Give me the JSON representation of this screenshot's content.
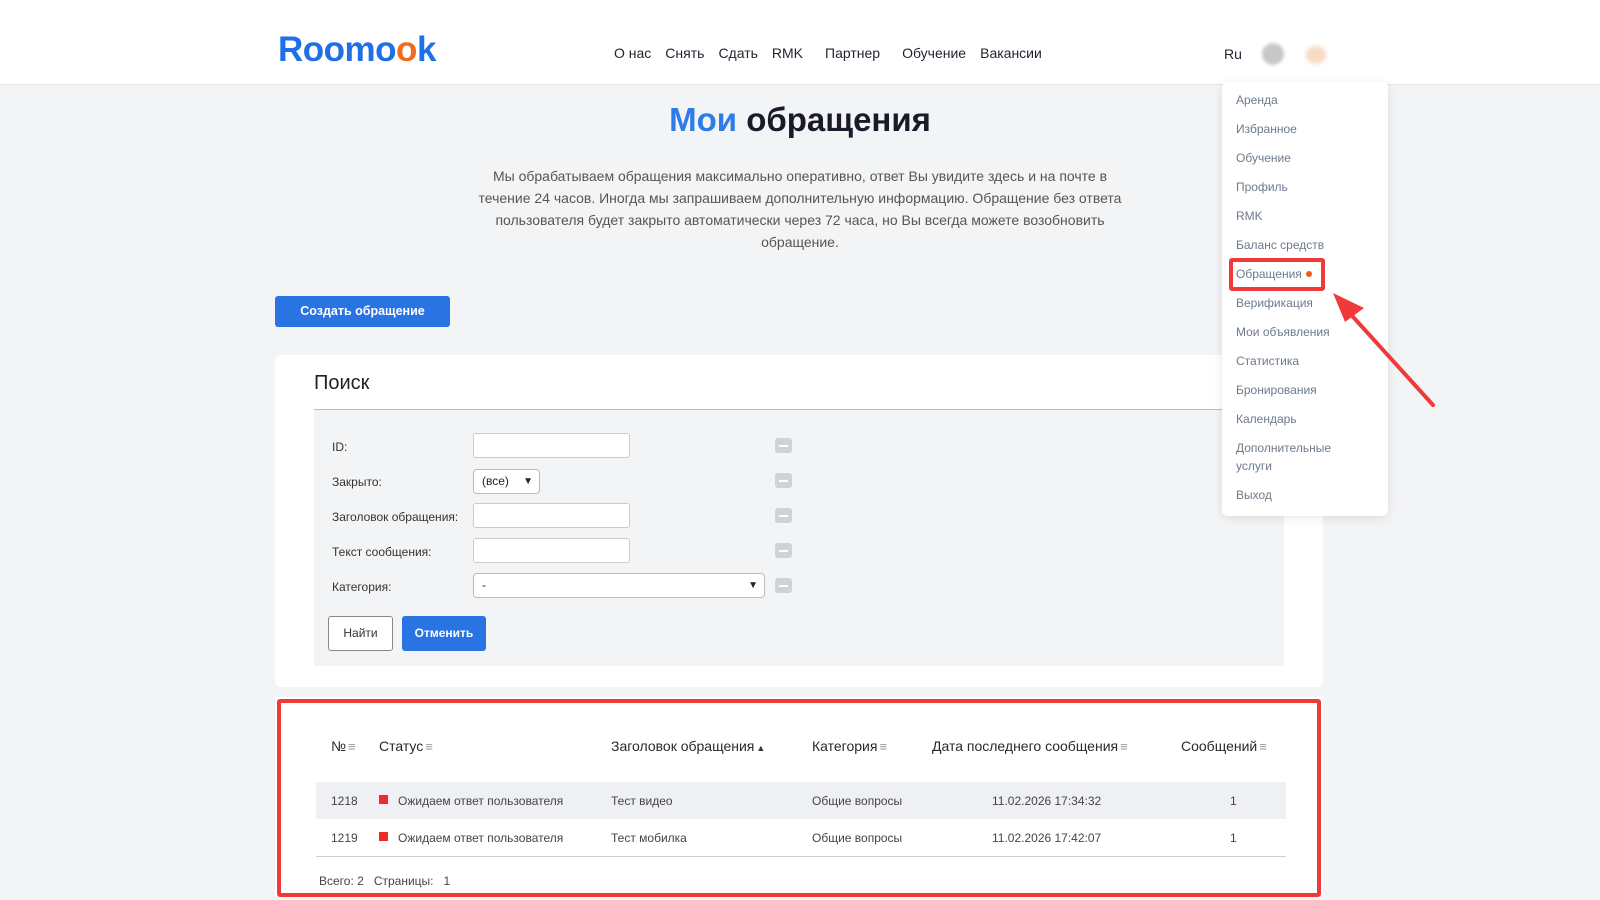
{
  "header": {
    "logo": "Roomook",
    "nav": [
      "О нас",
      "Снять",
      "Сдать",
      "RMK",
      "Партнер",
      "Обучение",
      "Вакансии"
    ],
    "lang": "Ru"
  },
  "page": {
    "title_blue": "Мои",
    "title_dark": "обращения",
    "intro": "Мы обрабатываем обращения максимально оперативно, ответ Вы увидите здесь и на почте в течение 24 часов. Иногда мы запрашиваем дополнительную информацию. Обращение без ответа пользователя будет закрыто автоматически через 72 часа, но Вы всегда можете возобновить обращение.",
    "create_button": "Создать обращение"
  },
  "search": {
    "title": "Поиск",
    "fields": {
      "id": "ID:",
      "closed": "Закрыто:",
      "closed_value": "(все)",
      "subject": "Заголовок обращения:",
      "message": "Текст сообщения:",
      "category": "Категория:",
      "category_value": "-"
    },
    "find_button": "Найти",
    "cancel_button": "Отменить"
  },
  "table": {
    "columns": [
      "№",
      "Статус",
      "Заголовок обращения",
      "Категория",
      "Дата последнего сообщения",
      "Сообщений"
    ],
    "rows": [
      {
        "id": "1218",
        "status": "Ожидаем ответ пользователя",
        "subject": "Тест видео",
        "category": "Общие вопросы",
        "date": "11.02.2026 17:34:32",
        "messages": "1"
      },
      {
        "id": "1219",
        "status": "Ожидаем ответ пользователя",
        "subject": "Тест мобилка",
        "category": "Общие вопросы",
        "date": "11.02.2026 17:42:07",
        "messages": "1"
      }
    ],
    "total_label": "Всего: 2",
    "pages_label": "Страницы:",
    "page_number": "1"
  },
  "dropdown": {
    "items": [
      "Аренда",
      "Избранное",
      "Обучение",
      "Профиль",
      "RMK",
      "Баланс средств",
      "Обращения",
      "Верификация",
      "Мои объявления",
      "Статистика",
      "Бронирования",
      "Календарь",
      "Дополнительные услуги",
      "Выход"
    ]
  },
  "colors": {
    "accent": "#2a73e3",
    "highlight": "#f03a3a",
    "status_waiting": "#ee2b2b",
    "logo_orange": "#f36b21"
  },
  "icons": {
    "sort": "sort-lines-icon",
    "sort_asc": "caret-up-icon",
    "remove_filter": "minus-icon",
    "select_chevron": "chevron-down-icon",
    "notification": "dot-icon"
  }
}
